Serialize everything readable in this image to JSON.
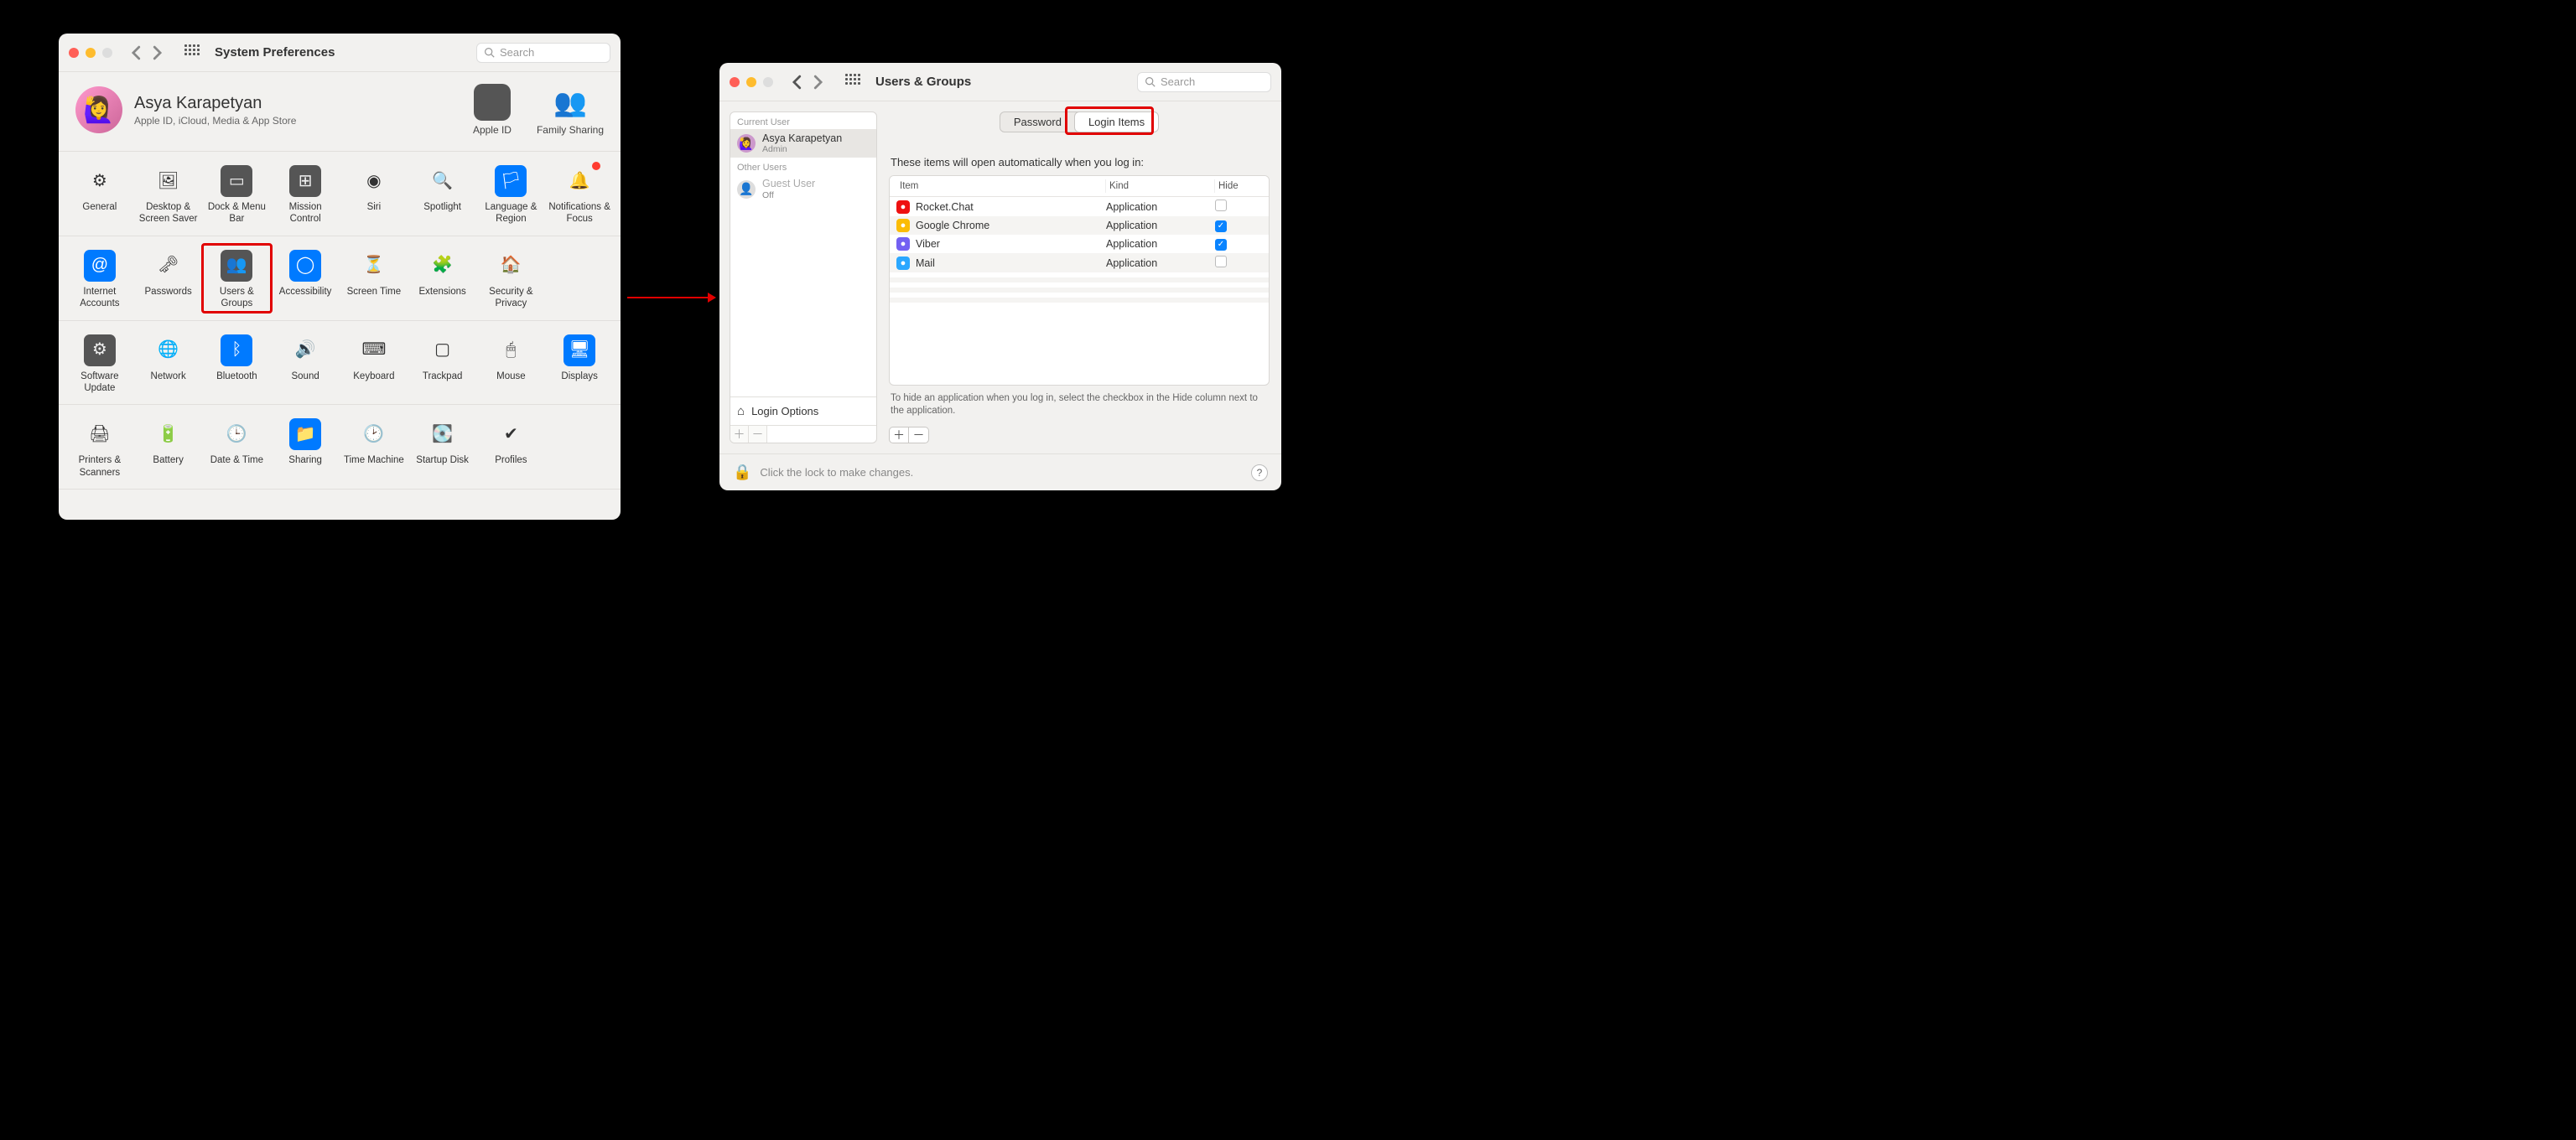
{
  "win1": {
    "title": "System Preferences",
    "search_placeholder": "Search",
    "account": {
      "name": "Asya Karapetyan",
      "sub": "Apple ID, iCloud, Media & App Store",
      "tiles": [
        {
          "label": "Apple ID",
          "icon": "apple-logo"
        },
        {
          "label": "Family Sharing",
          "icon": "family"
        }
      ]
    },
    "rows": [
      [
        {
          "label": "General",
          "icon": "general"
        },
        {
          "label": "Desktop & Screen Saver",
          "icon": "desktop"
        },
        {
          "label": "Dock & Menu Bar",
          "icon": "dock"
        },
        {
          "label": "Mission Control",
          "icon": "mission"
        },
        {
          "label": "Siri",
          "icon": "siri"
        },
        {
          "label": "Spotlight",
          "icon": "spotlight"
        },
        {
          "label": "Language & Region",
          "icon": "language"
        },
        {
          "label": "Notifications & Focus",
          "icon": "notifications",
          "badge": true
        }
      ],
      [
        {
          "label": "Internet Accounts",
          "icon": "internet"
        },
        {
          "label": "Passwords",
          "icon": "passwords"
        },
        {
          "label": "Users & Groups",
          "icon": "users",
          "highlight": true
        },
        {
          "label": "Accessibility",
          "icon": "accessibility"
        },
        {
          "label": "Screen Time",
          "icon": "screentime"
        },
        {
          "label": "Extensions",
          "icon": "extensions"
        },
        {
          "label": "Security & Privacy",
          "icon": "security"
        }
      ],
      [
        {
          "label": "Software Update",
          "icon": "update"
        },
        {
          "label": "Network",
          "icon": "network"
        },
        {
          "label": "Bluetooth",
          "icon": "bluetooth"
        },
        {
          "label": "Sound",
          "icon": "sound"
        },
        {
          "label": "Keyboard",
          "icon": "keyboard"
        },
        {
          "label": "Trackpad",
          "icon": "trackpad"
        },
        {
          "label": "Mouse",
          "icon": "mouse"
        },
        {
          "label": "Displays",
          "icon": "displays"
        }
      ],
      [
        {
          "label": "Printers & Scanners",
          "icon": "printers"
        },
        {
          "label": "Battery",
          "icon": "battery"
        },
        {
          "label": "Date & Time",
          "icon": "datetime"
        },
        {
          "label": "Sharing",
          "icon": "sharing"
        },
        {
          "label": "Time Machine",
          "icon": "timemachine"
        },
        {
          "label": "Startup Disk",
          "icon": "startup"
        },
        {
          "label": "Profiles",
          "icon": "profiles"
        }
      ]
    ]
  },
  "win2": {
    "title": "Users & Groups",
    "search_placeholder": "Search",
    "sidebar": {
      "current_label": "Current User",
      "other_label": "Other Users",
      "current": {
        "name": "Asya Karapetyan",
        "role": "Admin"
      },
      "others": [
        {
          "name": "Guest User",
          "role": "Off"
        }
      ],
      "login_options": "Login Options"
    },
    "tabs": {
      "password": "Password",
      "login_items": "Login Items"
    },
    "desc": "These items will open automatically when you log in:",
    "columns": {
      "item": "Item",
      "kind": "Kind",
      "hide": "Hide"
    },
    "items": [
      {
        "name": "Rocket.Chat",
        "kind": "Application",
        "hide": false,
        "color": "#e11"
      },
      {
        "name": "Google Chrome",
        "kind": "Application",
        "hide": true,
        "color": "#fbbc05"
      },
      {
        "name": "Viber",
        "kind": "Application",
        "hide": true,
        "color": "#7360f2"
      },
      {
        "name": "Mail",
        "kind": "Application",
        "hide": false,
        "color": "#2aa7ff"
      }
    ],
    "hint": "To hide an application when you log in, select the checkbox in the Hide column next to the application.",
    "lock_text": "Click the lock to make changes."
  }
}
